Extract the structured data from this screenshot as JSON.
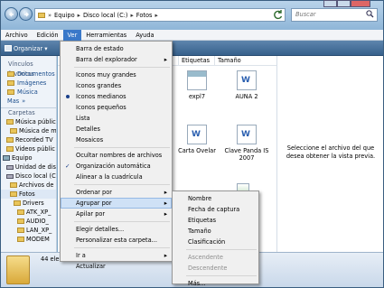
{
  "address": {
    "crumbs": [
      "Equipo",
      "Disco local (C:)",
      "Fotos"
    ]
  },
  "search": {
    "placeholder": "Buscar"
  },
  "menubar": {
    "items": [
      "Archivo",
      "Edición",
      "Ver",
      "Herramientas",
      "Ayuda"
    ]
  },
  "toolbar": {
    "organize": "Organizar"
  },
  "nav": {
    "favorites_header": "Vínculos favoritos",
    "favorites": [
      "Documentos",
      "Imágenes",
      "Música",
      "Mas"
    ],
    "folders_header": "Carpetas",
    "tree": [
      "Música públic",
      "Música de m",
      "Recorded TV",
      "Videos públic",
      "Equipo",
      "Unidad de dis",
      "Disco local (C",
      "Archivos de",
      "Fotos",
      "Drivers",
      "ATK_XP_",
      "AUDIO_",
      "LAN_XP_",
      "MODEM"
    ]
  },
  "columns": [
    "Etiquetas",
    "Tamaño"
  ],
  "files": [
    {
      "name": "expl7",
      "icon": "image-thumbnail-icon"
    },
    {
      "name": "AUNA 2",
      "icon": "word-document-icon"
    },
    {
      "name": "Carta Ovelar",
      "icon": "word-document-icon"
    },
    {
      "name": "Clave Panda IS 2007",
      "icon": "word-document-icon"
    }
  ],
  "preview": {
    "message": "Seleccione el archivo del que desea obtener la vista previa."
  },
  "details": {
    "count": "44 ele"
  },
  "view_menu": {
    "items": [
      "Barra de estado",
      "Barra del explorador",
      "Iconos muy grandes",
      "Iconos grandes",
      "Iconos medianos",
      "Iconos pequeños",
      "Lista",
      "Detalles",
      "Mosaicos",
      "Ocultar nombres de archivos",
      "Organización automática",
      "Alinear a la cuadrícula",
      "Ordenar por",
      "Agrupar por",
      "Apilar por",
      "Elegir detalles...",
      "Personalizar esta carpeta...",
      "Ir a",
      "Actualizar"
    ],
    "selected_view": "Iconos medianos",
    "checked": [
      "Organización automática"
    ],
    "highlighted": "Agrupar por"
  },
  "group_menu": {
    "items": [
      "Nombre",
      "Fecha de captura",
      "Etiquetas",
      "Tamaño",
      "Clasificación",
      "Ascendente",
      "Descendente",
      "Más..."
    ]
  },
  "colors": {
    "accent": "#3a78c9",
    "menu_highlight": "#cfe1f6",
    "toolbar": "#4a73a0"
  }
}
